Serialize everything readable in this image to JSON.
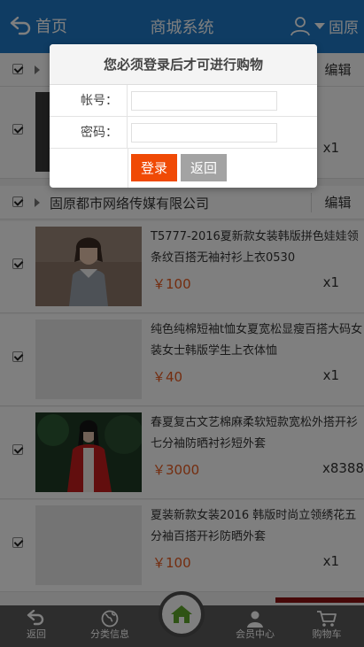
{
  "header": {
    "back_label": "首页",
    "title": "商城系统",
    "user_label": "固原"
  },
  "shops": [
    {
      "name": "",
      "edit_label": "编辑"
    },
    {
      "name": "固原都市网络传媒有限公司",
      "edit_label": "编辑"
    }
  ],
  "items": [
    {
      "title": "",
      "price": "",
      "qty": "x1"
    },
    {
      "title": "T5777-2016夏新款女装韩版拼色娃娃领条纹百搭无袖衬衫上衣0530",
      "price": "￥100",
      "qty": "x1"
    },
    {
      "title": "纯色纯棉短袖t恤女夏宽松显瘦百搭大码女装女士韩版学生上衣体恤",
      "price": "￥40",
      "qty": "x1"
    },
    {
      "title": "春夏复古文艺棉麻柔软短款宽松外搭开衫七分袖防晒衬衫短外套",
      "price": "￥3000",
      "qty": "x8388"
    },
    {
      "title": "夏装新款女装2016 韩版时尚立领绣花五分袖百搭开衫防晒外套",
      "price": "￥100",
      "qty": "x1"
    }
  ],
  "login": {
    "title": "您必须登录后才可进行购物",
    "account_label": "帐号：",
    "password_label": "密码：",
    "account_value": "",
    "password_value": "",
    "login_button": "登录",
    "back_button": "返回"
  },
  "bottom_nav": {
    "back": "返回",
    "category": "分类信息",
    "member": "会员中心",
    "cart": "购物车"
  },
  "colors": {
    "header_bg": "#1e79c7",
    "price": "#e85a1f",
    "login_button": "#f04a05",
    "back_button": "#a3a3a3",
    "bottom_bar": "#5b5b5b",
    "home_icon": "#5fa62a"
  },
  "icons": [
    "back-arrow-icon",
    "user-icon",
    "caret-down-icon",
    "globe-icon",
    "home-icon",
    "person-icon",
    "cart-icon"
  ]
}
